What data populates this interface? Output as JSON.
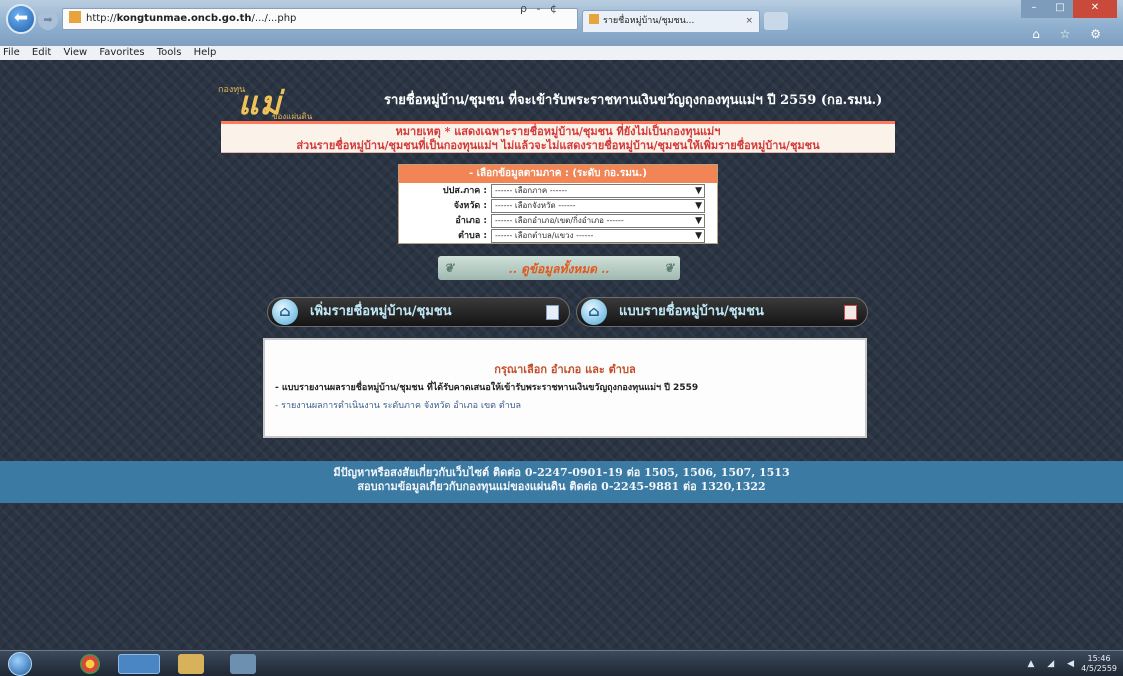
{
  "browser": {
    "url_prefix": "http://",
    "url_host": "kongtunmae.oncb.go.th",
    "url_path": "/.../...php",
    "addr_controls": "ρ - ¢",
    "tab_title": "รายชื่อหมู่บ้าน/ชุมชน...",
    "tab_close": "×",
    "win_min": "–",
    "win_max": "□",
    "win_close": "✕",
    "toolbar_icons": "⌂ ☆ ⚙"
  },
  "menu": [
    "File",
    "Edit",
    "View",
    "Favorites",
    "Tools",
    "Help"
  ],
  "header": {
    "logo_small": "กองทุน",
    "logo_main": "แม่",
    "logo_sub": "ของแผ่นดิน",
    "title": "รายชื่อหมู่บ้าน/ชุมชน ที่จะเข้ารับพระราชทานเงินขวัญถุงกองทุนแม่ฯ ปี 2559 (กอ.รมน.)"
  },
  "notice": {
    "line1": "หมายเหตุ * แสดงเฉพาะรายชื่อหมู่บ้าน/ชุมชน ที่ยังไม่เป็นกองทุนแม่ฯ",
    "line2": "ส่วนรายชื่อหมู่บ้าน/ชุมชนที่เป็นกองทุนแม่ฯ ไม่แล้วจะไม่แสดงรายชื่อหมู่บ้าน/ชุมชนให้เพิ่มรายชื่อหมู่บ้าน/ชุมชน"
  },
  "selector": {
    "heading": "- เลือกข้อมูลตามภาค : (ระดับ กอ.รมน.)",
    "fields": [
      {
        "label": "ปปส.ภาค :",
        "value": "------ เลือกภาค ------"
      },
      {
        "label": "จังหวัด :",
        "value": "------ เลือกจังหวัด ------"
      },
      {
        "label": "อำเภอ :",
        "value": "------ เลือกอำเภอ/เขต/กิ่งอำเภอ ------"
      },
      {
        "label": "ตำบล :",
        "value": "------ เลือกตำบล/แขวง ------"
      }
    ]
  },
  "ornate_button": {
    "label": ".. ดูข้อมูลทั้งหมด .."
  },
  "buttons": {
    "left": "เพิ่มรายชื่อหมู่บ้าน/ชุมชน",
    "right": "แบบรายชื่อหมู่บ้าน/ชุมชน"
  },
  "info": {
    "title": "กรุณาเลือก อำเภอ และ ตำบล",
    "line1": "- แบบรายงานผลรายชื่อหมู่บ้าน/ชุมชน ที่ได้รับคาดเสนอให้เข้ารับพระราชทานเงินขวัญถุงกองทุนแม่ฯ ปี 2559",
    "line2": "- รายงานผลการดำเนินงาน ระดับภาค จังหวัด อำเภอ เขต ตำบล"
  },
  "footer": {
    "line1": "มีปัญหาหรือสงสัยเกี่ยวกับเว็บไซต์ ติดต่อ 0-2247-0901-19 ต่อ 1505, 1506, 1507, 1513",
    "line2": "สอบถามข้อมูลเกี่ยวกับกองทุนแม่ของแผ่นดิน ติดต่อ 0-2245-9881 ต่อ 1320,1322"
  },
  "taskbar": {
    "tray": "▲ ◢ ◀",
    "time": "15:46",
    "date": "4/5/2559"
  },
  "colors": {
    "page_bg": "#2a3443",
    "notice_text": "#d43a3a",
    "selector_head": "#f28556",
    "footer_band": "#3b7aa3"
  }
}
